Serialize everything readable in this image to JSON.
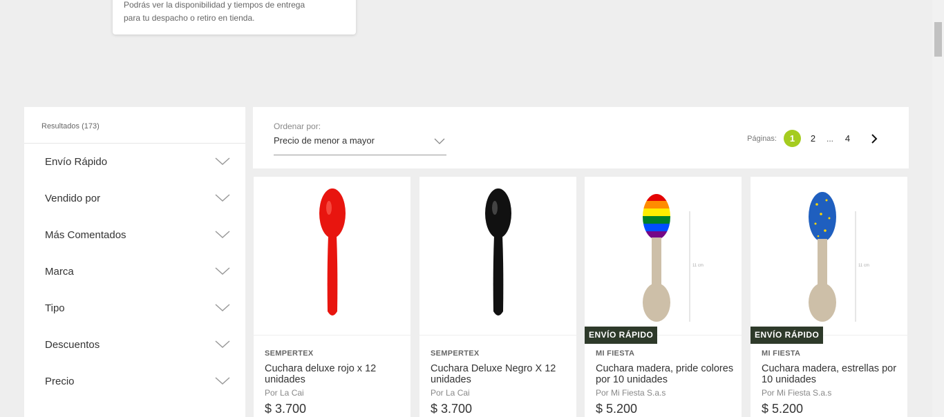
{
  "tooltip": {
    "line1": "Podrás ver la disponibilidad y tiempos de entrega",
    "line2": "para tu despacho o retiro en tienda."
  },
  "sidebar": {
    "results": "Resultados (173)",
    "filters": [
      {
        "label": "Envío Rápido"
      },
      {
        "label": "Vendido por"
      },
      {
        "label": "Más Comentados"
      },
      {
        "label": "Marca"
      },
      {
        "label": "Tipo"
      },
      {
        "label": "Descuentos"
      },
      {
        "label": "Precio"
      }
    ]
  },
  "toolbar": {
    "sort_title": "Ordenar por:",
    "sort_value": "Precio de menor a mayor",
    "pages_label": "Páginas:",
    "pages": [
      "1",
      "2",
      "4"
    ],
    "ellipsis": "...",
    "active_color": "#a5cc1f"
  },
  "products": [
    {
      "brand": "SEMPERTEX",
      "name": "Cuchara deluxe rojo x 12 unidades",
      "seller": "Por La Cai",
      "price": "$ 3.700",
      "badge": "",
      "spoon_color": "red"
    },
    {
      "brand": "SEMPERTEX",
      "name": "Cuchara Deluxe Negro X 12 unidades",
      "seller": "Por La Cai",
      "price": "$ 3.700",
      "badge": "",
      "spoon_color": "black"
    },
    {
      "brand": "MI FIESTA",
      "name": "Cuchara madera, pride colores por 10 unidades",
      "seller": "Por Mi Fiesta S.a.s",
      "price": "$ 5.200",
      "badge": "ENVÍO RÁPIDO",
      "spoon_color": "rainbow"
    },
    {
      "brand": "MI FIESTA",
      "name": "Cuchara madera, estrellas por 10 unidades",
      "seller": "Por Mi Fiesta S.a.s",
      "price": "$ 5.200",
      "badge": "ENVÍO RÁPIDO",
      "spoon_color": "stars"
    }
  ]
}
